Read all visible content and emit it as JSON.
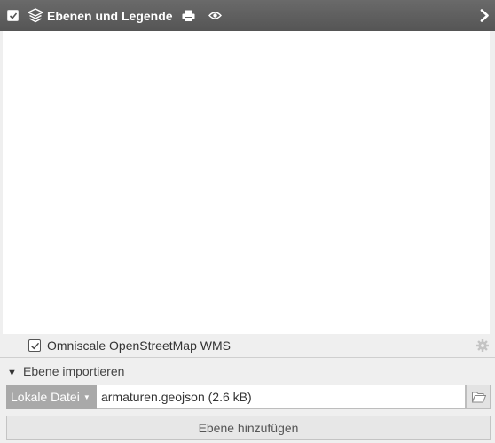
{
  "header": {
    "title": "Ebenen und Legende",
    "checked": true,
    "icons": [
      "layers-icon",
      "print-icon",
      "eye-icon",
      "collapse-right-icon"
    ]
  },
  "layers": [
    {
      "label": "Omniscale OpenStreetMap WMS",
      "checked": true
    }
  ],
  "import": {
    "toggle_label": "Ebene importieren",
    "expanded": true,
    "source_select": "Lokale Datei",
    "file_value": "armaturen.geojson (2.6 kB)",
    "add_button_label": "Ebene hinzufügen"
  },
  "colors": {
    "header_bg": "#5e5e5e",
    "panel_bg": "#efefef",
    "select_bg": "#a9a9a9"
  }
}
